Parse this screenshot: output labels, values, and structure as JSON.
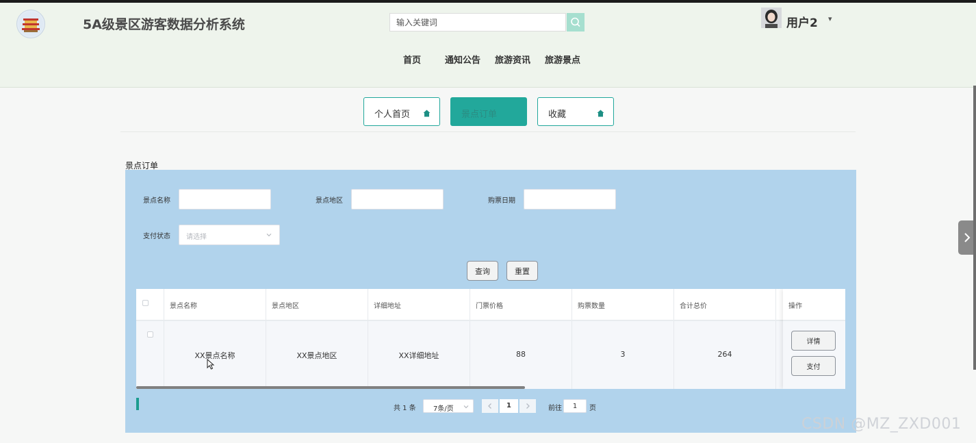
{
  "header": {
    "app_title": "5A级景区游客数据分析系统",
    "search_placeholder": "输入关键词",
    "username": "用户2",
    "user_caret": "▾"
  },
  "nav": {
    "items": [
      "首页",
      "通知公告",
      "旅游资讯",
      "旅游景点"
    ]
  },
  "tabs": {
    "items": [
      {
        "label": "个人首页",
        "active": false
      },
      {
        "label": "景点订单",
        "active": true
      },
      {
        "label": "收藏",
        "active": false
      }
    ]
  },
  "section": {
    "title": "景点订单"
  },
  "filters": {
    "name_label": "景点名称",
    "region_label": "景点地区",
    "date_label": "购票日期",
    "pay_status_label": "支付状态",
    "pay_status_placeholder": "请选择",
    "query_button": "查询",
    "reset_button": "重置"
  },
  "table": {
    "columns": [
      "景点名称",
      "景点地区",
      "详细地址",
      "门票价格",
      "购票数量",
      "合计总价",
      "操作"
    ],
    "rows": [
      {
        "name": "XX景点名称",
        "region": "XX景点地区",
        "address": "XX详细地址",
        "price": "88",
        "quantity": "3",
        "total": "264",
        "detail_button": "详情",
        "pay_button": "支付"
      }
    ]
  },
  "pagination": {
    "total_text": "共 1 条",
    "page_size": "7条/页",
    "current_page": "1",
    "goto_label": "前往",
    "goto_value": "1",
    "page_suffix": "页"
  },
  "watermark": "CSDN @MZ_ZXD001",
  "colors": {
    "accent": "#22a89b",
    "panel_bg": "#b1d3ec",
    "header_bg": "#eef4ec",
    "search_button": "#a6dfcf"
  }
}
